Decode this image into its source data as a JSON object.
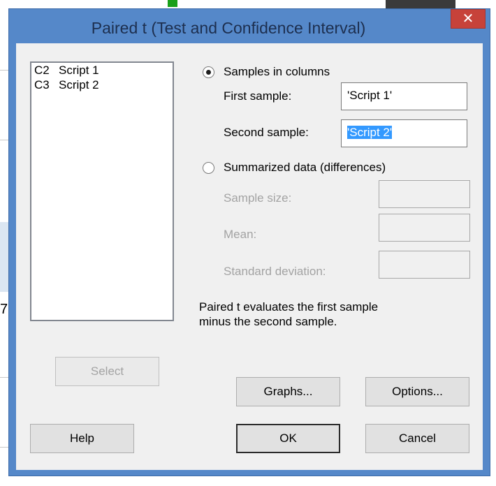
{
  "dialog": {
    "title": "Paired t (Test and Confidence Interval)",
    "close_glyph": "✕"
  },
  "variables": [
    {
      "col": "C2",
      "name": "Script 1"
    },
    {
      "col": "C3",
      "name": "Script 2"
    }
  ],
  "mode": {
    "samples_in_columns": {
      "label": "Samples in columns",
      "selected": true
    },
    "summarized": {
      "label": "Summarized data (differences)",
      "selected": false
    }
  },
  "fields": {
    "first_sample": {
      "label": "First sample:",
      "value": "'Script 1'"
    },
    "second_sample": {
      "label": "Second sample:",
      "value": "'Script 2'"
    },
    "sample_size": {
      "label": "Sample size:",
      "value": ""
    },
    "mean": {
      "label": "Mean:",
      "value": ""
    },
    "std_dev": {
      "label": "Standard deviation:",
      "value": ""
    }
  },
  "note": {
    "line1": "Paired t evaluates the first sample",
    "line2": "minus the second sample."
  },
  "buttons": {
    "select": "Select",
    "graphs": "Graphs...",
    "options": "Options...",
    "help": "Help",
    "ok": "OK",
    "cancel": "Cancel"
  },
  "background": {
    "edge_digit": "7"
  },
  "colors": {
    "title_bar": "#5588c9",
    "close_button": "#c7423a",
    "selection": "#3399ff"
  }
}
